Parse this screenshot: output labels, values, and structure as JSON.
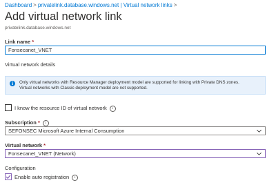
{
  "breadcrumb": {
    "items": [
      "Dashboard",
      "privatelink.database.windows.net | Virtual network links"
    ],
    "separator": ">"
  },
  "page": {
    "title": "Add virtual network link",
    "subtitle": "privatelink.database.windows.net"
  },
  "link_name": {
    "label": "Link name",
    "required_mark": "*",
    "value": "Fonsecanet_VNET"
  },
  "vnet_details": {
    "heading": "Virtual network details",
    "info_line1": "Only virtual networks with Resource Manager deployment model are supported for linking with Private DNS zones.",
    "info_line2": "Virtual networks with Classic deployment model are not supported.",
    "info_icon": "info-icon"
  },
  "resource_id": {
    "label": "I know the resource ID of virtual network",
    "checked": false
  },
  "subscription": {
    "label": "Subscription",
    "required_mark": "*",
    "value": "SEFONSEC Microsoft Azure Internal Consumption"
  },
  "virtual_network": {
    "label": "Virtual network",
    "required_mark": "*",
    "value": "Fonsecanet_VNET (Network)"
  },
  "configuration": {
    "heading": "Configuration",
    "auto_registration_label": "Enable auto registration",
    "auto_registration_checked": true
  },
  "tooltip_glyph": "i",
  "colors": {
    "link": "#0078d4",
    "focus_border": "#0078d4",
    "selected_border": "#8764b8",
    "info_bg": "#e8f1fb",
    "required": "#a4262c"
  }
}
